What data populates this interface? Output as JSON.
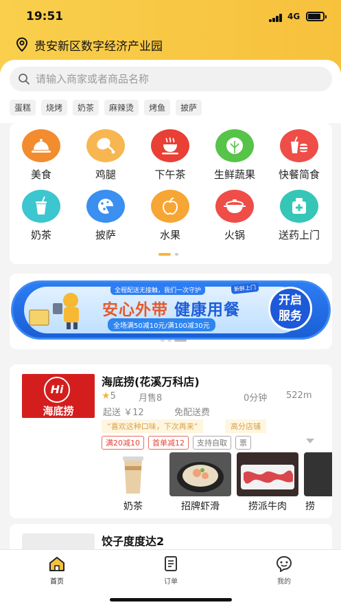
{
  "status_bar": {
    "time": "19:51",
    "network": "4G"
  },
  "location": {
    "address": "贵安新区数字经济产业园"
  },
  "search": {
    "placeholder": "请输入商家或者商品名称"
  },
  "hot_tags": [
    "蛋糕",
    "烧烤",
    "奶茶",
    "麻辣烫",
    "烤鱼",
    "披萨"
  ],
  "categories": [
    {
      "label": "美食",
      "icon": "food-cloche-icon",
      "color": "#f28c2f"
    },
    {
      "label": "鸡腿",
      "icon": "chicken-leg-icon",
      "color": "#f7b650"
    },
    {
      "label": "下午茶",
      "icon": "tea-cup-icon",
      "color": "#e93f35"
    },
    {
      "label": "生鲜蔬果",
      "icon": "cabbage-icon",
      "color": "#55c448"
    },
    {
      "label": "快餐简食",
      "icon": "fast-food-icon",
      "color": "#ee4e47"
    },
    {
      "label": "奶茶",
      "icon": "milk-tea-icon",
      "color": "#3cc6cf"
    },
    {
      "label": "披萨",
      "icon": "pizza-icon",
      "color": "#3a8ff0"
    },
    {
      "label": "水果",
      "icon": "apple-icon",
      "color": "#f7a534"
    },
    {
      "label": "火锅",
      "icon": "hotpot-icon",
      "color": "#ee4e47"
    },
    {
      "label": "送药上门",
      "icon": "medicine-box-icon",
      "color": "#35c6b8"
    }
  ],
  "banner": {
    "top_text": "全程配送无接触，我们一次守护",
    "headline_1": "安心外带",
    "headline_2": "健康用餐",
    "sub_text": "全场满50减10元/满100减30元",
    "badge": "新鲜上门",
    "button_label": "开启服务"
  },
  "shops": [
    {
      "name": "海底捞(花溪万科店)",
      "logo_text": "海底捞",
      "logo_mark": "Hi",
      "rating": "5",
      "monthly_sales": "月售8",
      "delivery_time": "0分钟",
      "distance": "522m",
      "min_order": "起送 ￥12",
      "delivery_fee": "免配送费",
      "quote": "“喜欢这种口味，下次再来”",
      "highlight": "高分店铺",
      "promos": [
        {
          "label": "满20减10",
          "style": "red"
        },
        {
          "label": "首单减12",
          "style": "red"
        },
        {
          "label": "支持自取",
          "style": "gray"
        },
        {
          "label": "票",
          "style": "gray"
        }
      ],
      "dishes": [
        "奶茶",
        "招牌虾滑",
        "捞派牛肉",
        "捞"
      ]
    },
    {
      "name": "饺子度度达2"
    }
  ],
  "tabbar": [
    {
      "label": "首页",
      "icon": "home-icon",
      "active": true
    },
    {
      "label": "订单",
      "icon": "orders-icon",
      "active": false
    },
    {
      "label": "我的",
      "icon": "profile-icon",
      "active": false
    }
  ]
}
